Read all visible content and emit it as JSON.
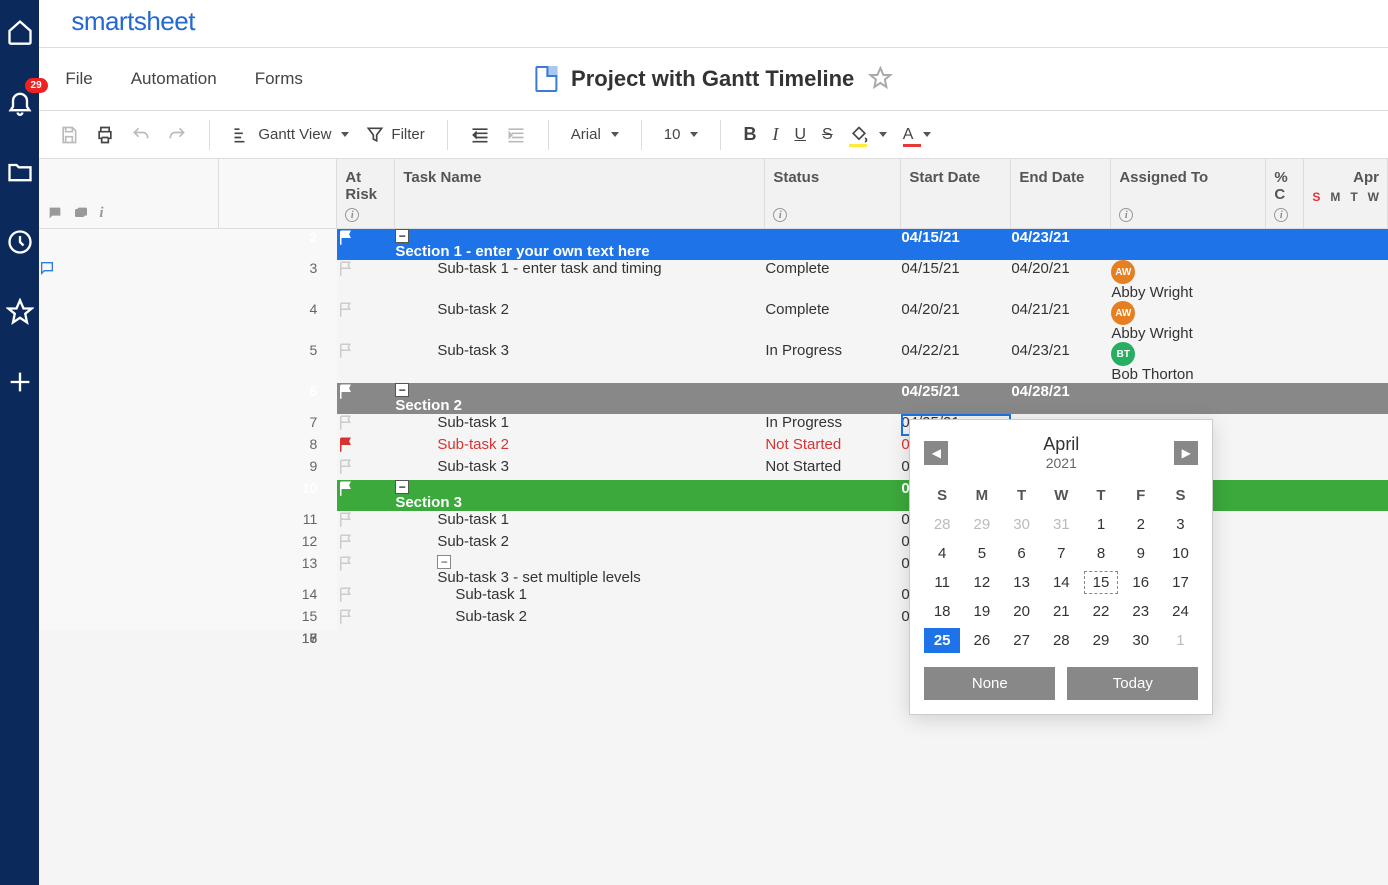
{
  "brand": "smartsheet",
  "notification_count": "29",
  "menu": {
    "file": "File",
    "automation": "Automation",
    "forms": "Forms"
  },
  "document": {
    "title": "Project with Gantt Timeline"
  },
  "toolbar": {
    "view": "Gantt View",
    "filter": "Filter",
    "font": "Arial",
    "size": "10"
  },
  "columns": {
    "at_risk": "At Risk",
    "task_name": "Task Name",
    "status": "Status",
    "start_date": "Start Date",
    "end_date": "End Date",
    "assigned_to": "Assigned To",
    "pct": "% C",
    "gantt_month": "Apr",
    "gantt_days": [
      "S",
      "M",
      "T",
      "W"
    ]
  },
  "rows": [
    {
      "num": "2",
      "type": "section1",
      "task": "Section 1 - enter your own text here",
      "start": "04/15/21",
      "end": "04/23/21"
    },
    {
      "num": "3",
      "comment": true,
      "task": "Sub-task 1 - enter task and timing",
      "status": "Complete",
      "start": "04/15/21",
      "end": "04/20/21",
      "assignee": "Abby Wright",
      "av": "AW",
      "avc": "orange"
    },
    {
      "num": "4",
      "task": "Sub-task 2",
      "status": "Complete",
      "start": "04/20/21",
      "end": "04/21/21",
      "assignee": "Abby Wright",
      "av": "AW",
      "avc": "orange"
    },
    {
      "num": "5",
      "task": "Sub-task 3",
      "status": "In Progress",
      "start": "04/22/21",
      "end": "04/23/21",
      "assignee": "Bob Thorton",
      "av": "BT",
      "avc": "green"
    },
    {
      "num": "6",
      "type": "section2",
      "task": "Section 2",
      "start": "04/25/21",
      "end": "04/28/21"
    },
    {
      "num": "7",
      "task": "Sub-task 1",
      "status": "In Progress",
      "start": "04/25/21",
      "active": true
    },
    {
      "num": "8",
      "red": true,
      "flag": "red",
      "task": "Sub-task 2",
      "status": "Not Started",
      "start": "04/26/21"
    },
    {
      "num": "9",
      "task": "Sub-task 3",
      "status": "Not Started",
      "start": "04/26/21"
    },
    {
      "num": "10",
      "type": "section3",
      "task": "Section 3",
      "start": "04/28/21",
      "gantt": true
    },
    {
      "num": "11",
      "task": "Sub-task 1",
      "start": "04/28/21"
    },
    {
      "num": "12",
      "task": "Sub-task 2",
      "start": "05/03/21"
    },
    {
      "num": "13",
      "task": "Sub-task 3 - set multiple levels",
      "start": "05/05/21",
      "collapse": true
    },
    {
      "num": "14",
      "indent": 2,
      "task": "Sub-task 1",
      "start": "05/05/21"
    },
    {
      "num": "15",
      "indent": 2,
      "task": "Sub-task 2",
      "start": "05/05/21"
    },
    {
      "num": "16"
    },
    {
      "num": "17"
    },
    {
      "num": "18"
    }
  ],
  "datepicker": {
    "month": "April",
    "year": "2021",
    "dow": [
      "S",
      "M",
      "T",
      "W",
      "T",
      "F",
      "S"
    ],
    "none": "None",
    "today": "Today"
  }
}
